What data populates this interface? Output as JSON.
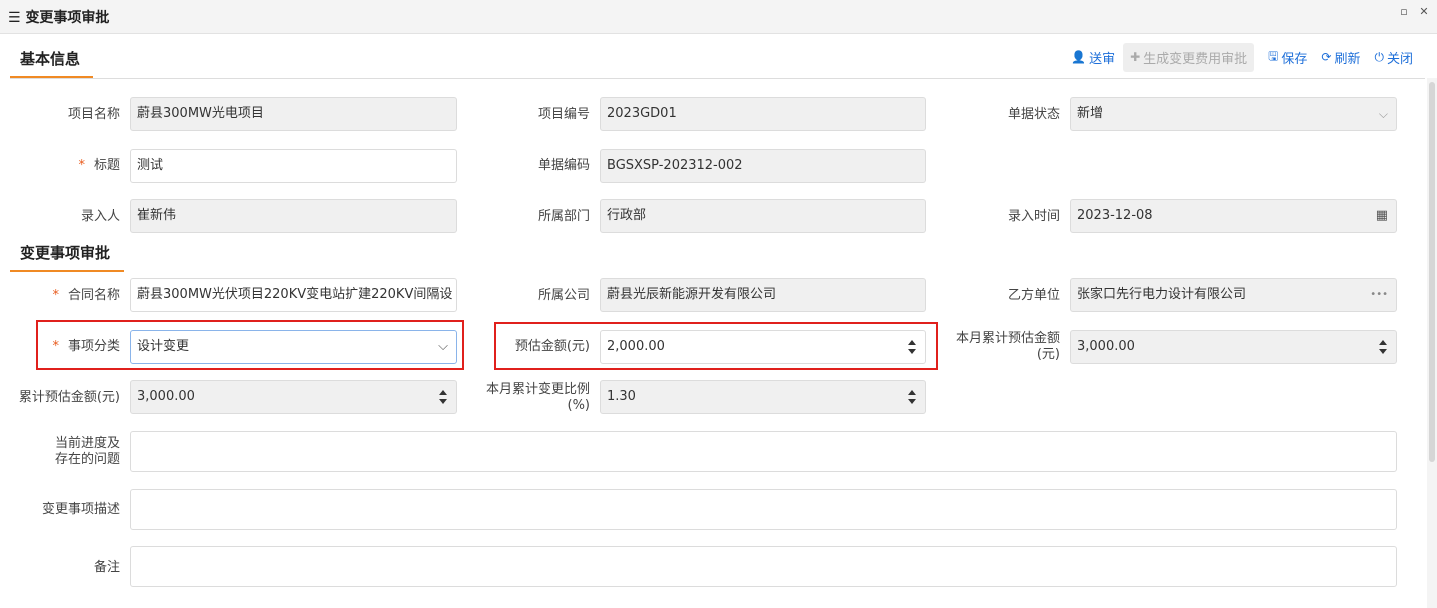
{
  "window": {
    "title": "变更事项审批"
  },
  "tabs": {
    "basic": "基本信息",
    "change": "变更事项审批"
  },
  "toolbar": {
    "submit": "送审",
    "generate": "生成变更费用审批",
    "save": "保存",
    "refresh": "刷新",
    "close": "关闭"
  },
  "fields": {
    "project_name": {
      "label": "项目名称",
      "value": "蔚县300MW光电项目"
    },
    "project_code": {
      "label": "项目编号",
      "value": "2023GD01"
    },
    "doc_status": {
      "label": "单据状态",
      "value": "新增"
    },
    "title": {
      "label": "标题",
      "value": "测试"
    },
    "doc_code": {
      "label": "单据编码",
      "value": "BGSXSP-202312-002"
    },
    "entered_by": {
      "label": "录入人",
      "value": "崔新伟"
    },
    "department": {
      "label": "所属部门",
      "value": "行政部"
    },
    "entry_time": {
      "label": "录入时间",
      "value": "2023-12-08"
    },
    "contract_name": {
      "label": "合同名称",
      "value": "蔚县300MW光伏项目220KV变电站扩建220KV间隔设"
    },
    "company": {
      "label": "所属公司",
      "value": "蔚县光辰新能源开发有限公司"
    },
    "party_b": {
      "label": "乙方单位",
      "value": "张家口先行电力设计有限公司"
    },
    "category": {
      "label": "事项分类",
      "value": "设计变更"
    },
    "est_amount": {
      "label": "预估金额(元)",
      "value": "2,000.00"
    },
    "month_cum_amount": {
      "label_line1": "本月累计预估金额",
      "label_line2": "(元)",
      "value": "3,000.00"
    },
    "cum_amount": {
      "label": "累计预估金额(元)",
      "value": "3,000.00"
    },
    "month_ratio": {
      "label_line1": "本月累计变更比例",
      "label_line2": "(%)",
      "value": "1.30"
    },
    "progress": {
      "label_line1": "当前进度及",
      "label_line2": "存在的问题",
      "value": ""
    },
    "description": {
      "label": "变更事项描述",
      "value": ""
    },
    "remark": {
      "label": "备注",
      "value": ""
    }
  },
  "required_mark": "*",
  "more_icon": "•••",
  "colors": {
    "accent": "#f08a24",
    "link": "#1e6fd9",
    "highlight": "#e0201c"
  }
}
